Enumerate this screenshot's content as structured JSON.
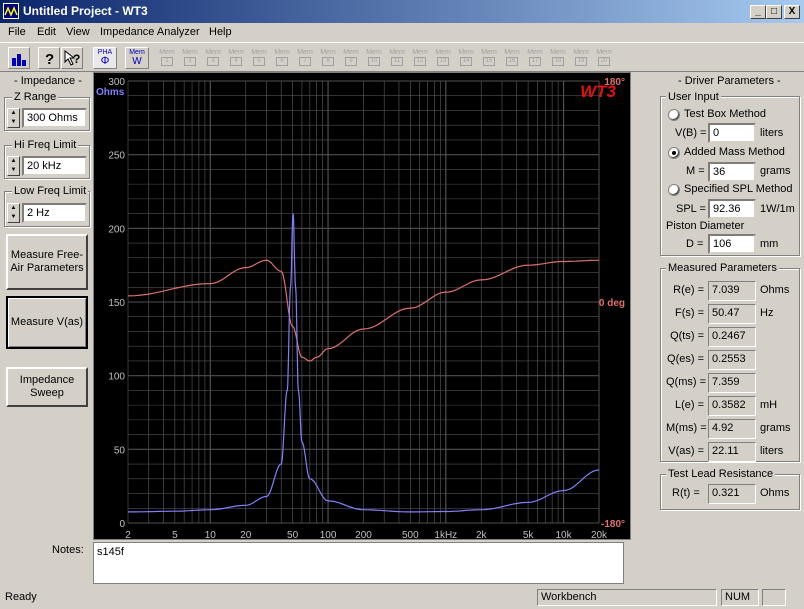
{
  "window": {
    "title": "Untitled Project - WT3",
    "controls": {
      "minimize": "_",
      "maximize": "□",
      "close": "X"
    }
  },
  "menu": [
    "File",
    "Edit",
    "View",
    "Impedance Analyzer",
    "Help"
  ],
  "toolbar": {
    "buttons": [
      "bar-chart-icon",
      "help-icon",
      "context-help-icon"
    ],
    "pha_label": "PHA",
    "pha_symbol": "Φ",
    "mem_label": "Mem",
    "mem_w": "W",
    "memory_slots": [
      "1",
      "2",
      "3",
      "4",
      "5",
      "6",
      "7",
      "8",
      "9",
      "10",
      "11",
      "12",
      "13",
      "14",
      "15",
      "16",
      "17",
      "18",
      "19",
      "20"
    ]
  },
  "impedance_panel": {
    "title": "- Impedance -",
    "z_range": {
      "label": "Z Range",
      "value": "300 Ohms"
    },
    "hi_freq": {
      "label": "Hi Freq Limit",
      "value": "20 kHz"
    },
    "low_freq": {
      "label": "Low Freq Limit",
      "value": "2 Hz"
    },
    "measure_free_air": "Measure Free-Air Parameters",
    "measure_vas": "Measure V(as)",
    "impedance_sweep": "Impedance Sweep"
  },
  "graph": {
    "logo": "WT3",
    "y_unit": "Ohms",
    "phase_labels": [
      "180°",
      "0 deg",
      "-180°"
    ],
    "y_ticks": [
      "300",
      "250",
      "200",
      "150",
      "100",
      "50",
      "0"
    ],
    "x_ticks": [
      "2",
      "5",
      "10",
      "20",
      "50",
      "100",
      "200",
      "500",
      "1kHz",
      "2k",
      "5k",
      "10k",
      "20k"
    ],
    "colors": {
      "impedance": "#8080ff",
      "phase": "#e07070",
      "grid": "#505050",
      "axis_text": "#c0c0c0"
    }
  },
  "chart_data": {
    "type": "line",
    "x_scale": "log",
    "xlim": [
      2,
      20000
    ],
    "ylim": [
      0,
      300
    ],
    "y2lim": [
      -180,
      180
    ],
    "series": [
      {
        "name": "Ohms",
        "x": [
          2,
          5,
          10,
          20,
          30,
          40,
          45,
          48,
          50.47,
          53,
          56,
          60,
          70,
          100,
          200,
          500,
          1000,
          2000,
          5000,
          10000,
          20000
        ],
        "values": [
          7.5,
          8,
          9,
          12,
          18,
          40,
          90,
          160,
          210,
          160,
          90,
          55,
          30,
          15,
          9,
          7.5,
          7.8,
          9,
          14,
          22,
          36
        ]
      },
      {
        "name": "Phase",
        "x": [
          2,
          10,
          20,
          30,
          40,
          50,
          60,
          70,
          80,
          100,
          200,
          500,
          1000,
          2000,
          5000,
          10000,
          20000
        ],
        "values": [
          5,
          15,
          28,
          34,
          25,
          -20,
          -45,
          -48,
          -45,
          -38,
          -22,
          -5,
          8,
          18,
          30,
          33,
          34
        ]
      }
    ],
    "grid": true
  },
  "driver_panel": {
    "title": "- Driver Parameters -",
    "user_input": "User Input",
    "test_box": {
      "label": "Test Box Method",
      "param": "V(B) =",
      "value": "0",
      "unit": "liters"
    },
    "added_mass": {
      "label": "Added Mass Method",
      "param": "M =",
      "value": "36",
      "unit": "grams"
    },
    "spl": {
      "label": "Specified SPL Method",
      "param": "SPL =",
      "value": "92.36",
      "unit": "1W/1m"
    },
    "piston": {
      "label": "Piston Diameter",
      "param": "D =",
      "value": "106",
      "unit": "mm"
    }
  },
  "measured": {
    "title": "Measured Parameters",
    "rows": [
      {
        "label": "R(e) =",
        "value": "7.039",
        "unit": "Ohms"
      },
      {
        "label": "F(s) =",
        "value": "50.47",
        "unit": "Hz"
      },
      {
        "label": "Q(ts) =",
        "value": "0.2467",
        "unit": ""
      },
      {
        "label": "Q(es) =",
        "value": "0.2553",
        "unit": ""
      },
      {
        "label": "Q(ms) =",
        "value": "7.359",
        "unit": ""
      },
      {
        "label": "L(e) =",
        "value": "0.3582",
        "unit": "mH"
      },
      {
        "label": "M(ms) =",
        "value": "4.92",
        "unit": "grams"
      },
      {
        "label": "V(as) =",
        "value": "22.11",
        "unit": "liters"
      }
    ]
  },
  "lead": {
    "title": "Test Lead Resistance",
    "label": "R(t) =",
    "value": "0.321",
    "unit": "Ohms"
  },
  "notes": {
    "label": "Notes:",
    "value": "s145f"
  },
  "status": {
    "text": "Ready",
    "mode": "Workbench",
    "num": "NUM"
  }
}
